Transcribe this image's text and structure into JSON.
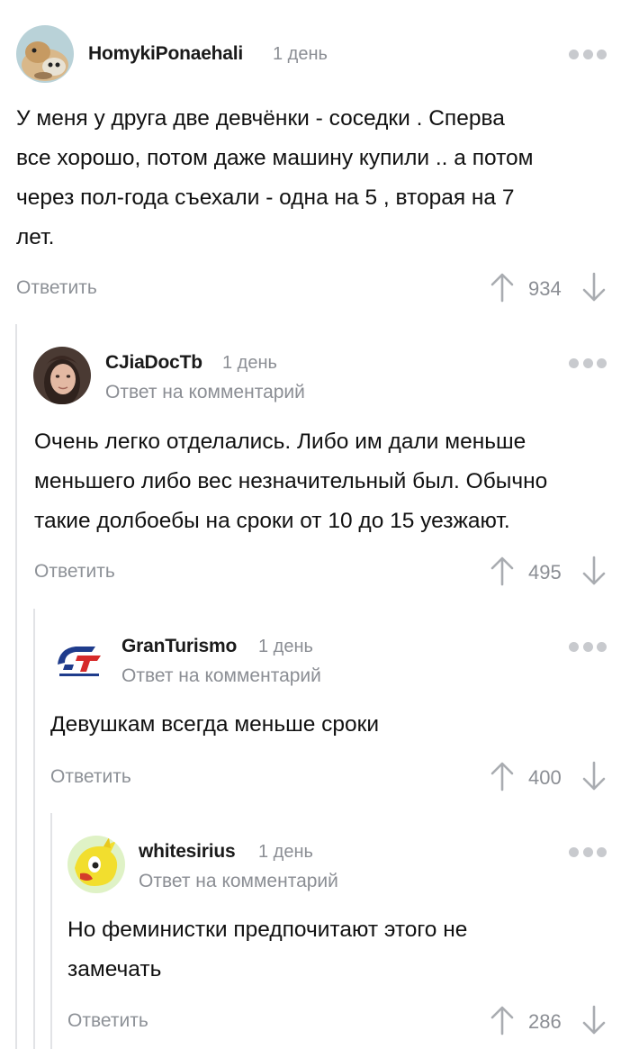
{
  "comments": [
    {
      "author": "HomykiPonaehali",
      "time": "1 день",
      "lines": [
        "У меня у друга две девчёнки - соседки . Сперва",
        "все хорошо, потом даже машину купили .. а потом",
        "через пол-года съехали - одна на 5 , вторая на 7",
        "лет."
      ],
      "reply_label": "Ответить",
      "votes": "934",
      "avatar_icon": "hamster-avatar"
    },
    {
      "author": "CJiaDocTb",
      "time": "1 день",
      "reply_prefix": "Ответ на",
      "reply_link": "комментарий",
      "lines": [
        "Очень легко отделались. Либо им дали меньше",
        "меньшего либо вес незначительный был. Обычно",
        "такие долбоебы на сроки от 10 до 15 уезжают."
      ],
      "reply_label": "Ответить",
      "votes": "495",
      "avatar_icon": "woman-photo-avatar"
    },
    {
      "author": "GranTurismo",
      "time": "1 день",
      "reply_prefix": "Ответ на",
      "reply_link": "комментарий",
      "lines": [
        "Девушкам всегда меньше сроки"
      ],
      "reply_label": "Ответить",
      "votes": "400",
      "avatar_icon": "gran-turismo-logo-avatar"
    },
    {
      "author": "whitesirius",
      "time": "1 день",
      "reply_prefix": "Ответ на",
      "reply_link": "комментарий",
      "lines": [
        "Но феминистки предпочитают этого не",
        "замечать"
      ],
      "reply_label": "Ответить",
      "votes": "286",
      "avatar_icon": "yellow-bird-avatar"
    }
  ],
  "colors": {
    "muted": "#8b8e94",
    "thread_line": "#e2e3e6",
    "dots": "#c8cace"
  }
}
